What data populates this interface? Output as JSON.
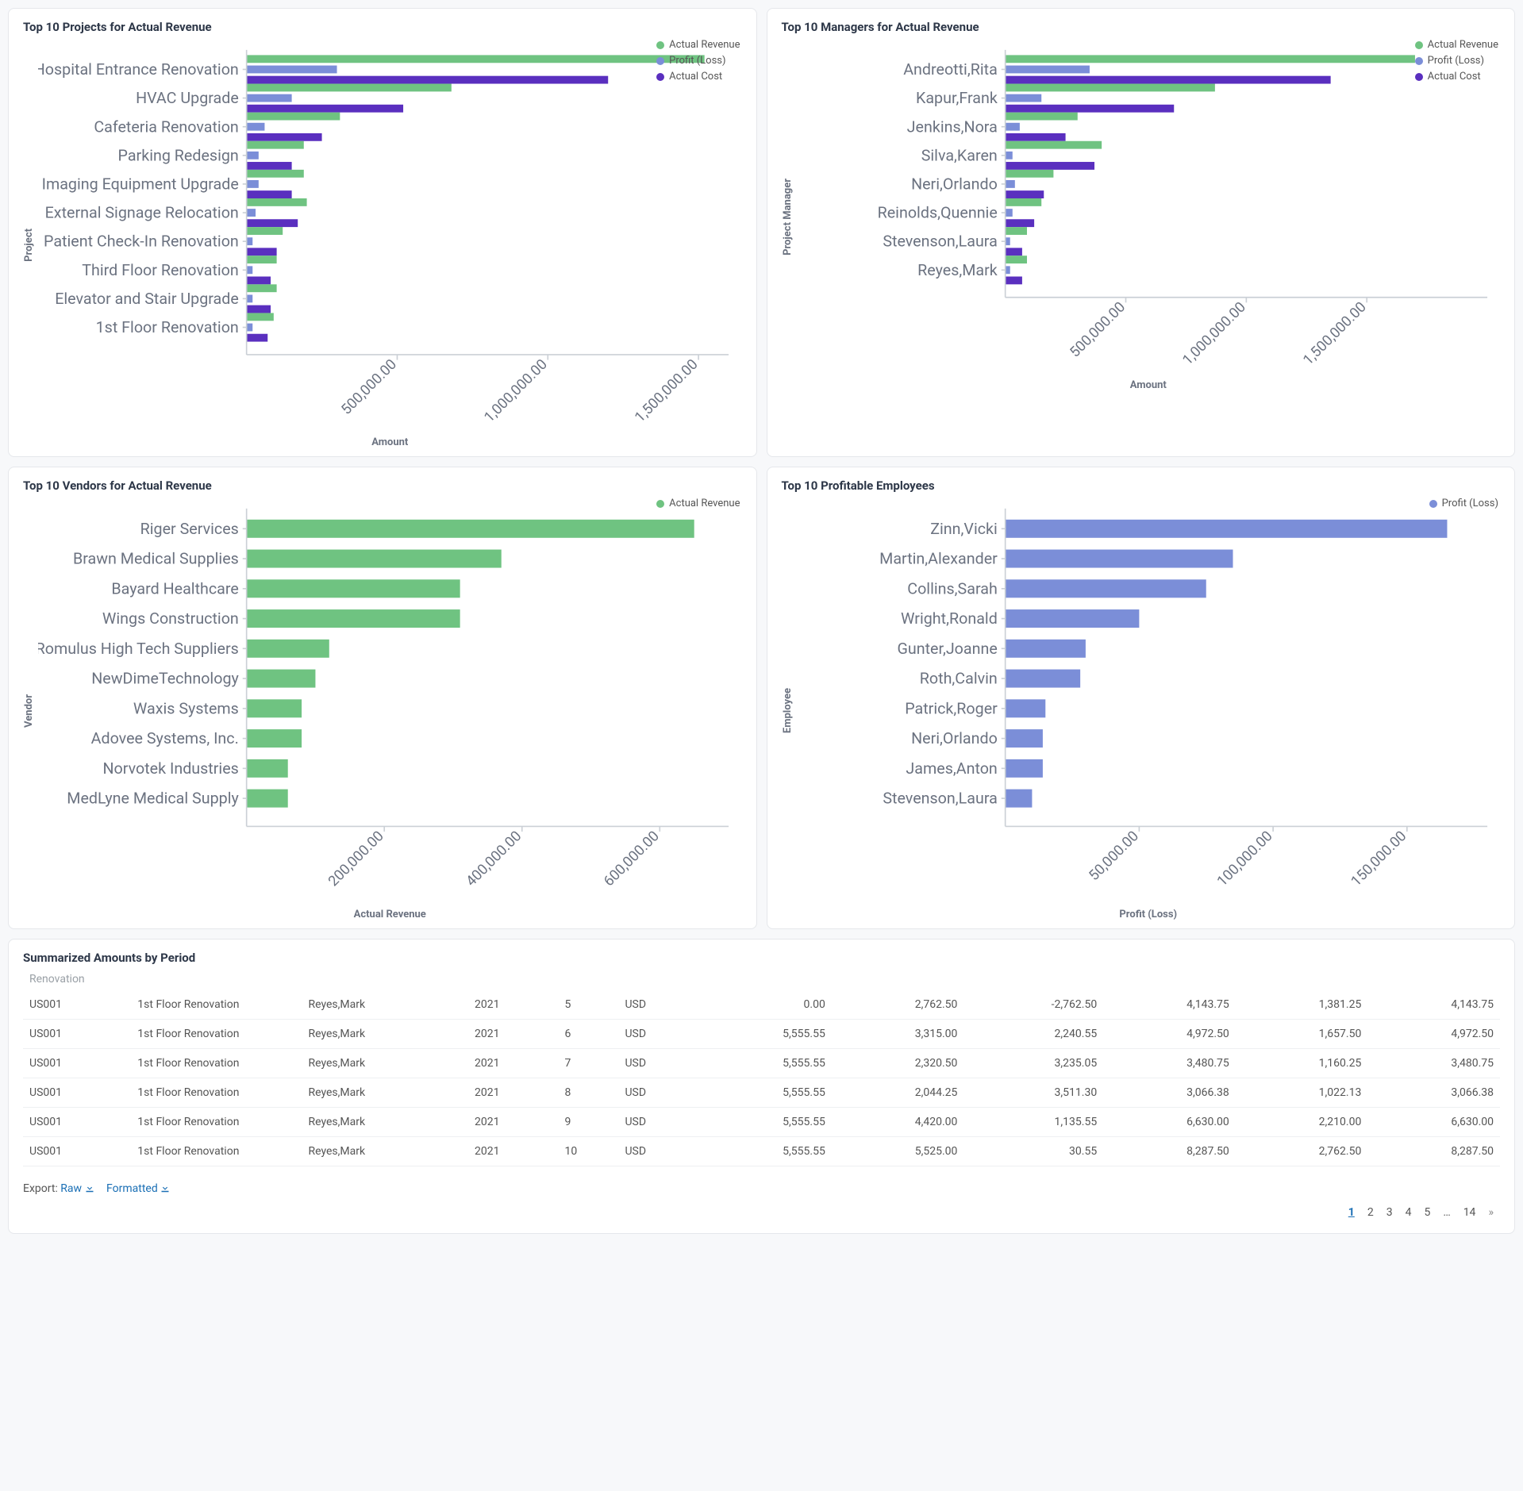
{
  "colors": {
    "green": "#6fc381",
    "blue": "#7b8ed8",
    "purple": "#5a2fbf"
  },
  "chart_data": [
    {
      "id": "projects",
      "type": "bar",
      "orientation": "horizontal",
      "title": "Top 10 Projects for Actual Revenue",
      "ylabel": "Project",
      "xlabel": "Amount",
      "xlim": [
        0,
        1600000
      ],
      "xticks": [
        "500,000.00",
        "1,000,000.00",
        "1,500,000.00"
      ],
      "xtick_vals": [
        500000,
        1000000,
        1500000
      ],
      "categories": [
        "Hospital Entrance Renovation",
        "HVAC Upgrade",
        "Cafeteria Renovation",
        "Parking Redesign",
        "Imaging Equipment Upgrade",
        "External Signage Relocation",
        "Patient Check-In Renovation",
        "Third Floor Renovation",
        "Elevator and Stair Upgrade",
        "1st Floor Renovation"
      ],
      "series": [
        {
          "name": "Actual Revenue",
          "color_key": "green",
          "values": [
            1520000,
            680000,
            310000,
            190000,
            190000,
            200000,
            120000,
            100000,
            100000,
            90000
          ]
        },
        {
          "name": "Profit (Loss)",
          "color_key": "blue",
          "values": [
            300000,
            150000,
            60000,
            40000,
            40000,
            30000,
            20000,
            20000,
            20000,
            20000
          ]
        },
        {
          "name": "Actual Cost",
          "color_key": "purple",
          "values": [
            1200000,
            520000,
            250000,
            150000,
            150000,
            170000,
            100000,
            80000,
            80000,
            70000
          ]
        }
      ]
    },
    {
      "id": "managers",
      "type": "bar",
      "orientation": "horizontal",
      "title": "Top 10 Managers for Actual Revenue",
      "ylabel": "Project Manager",
      "xlabel": "Amount",
      "xlim": [
        0,
        2000000
      ],
      "xticks": [
        "500,000.00",
        "1,000,000.00",
        "1,500,000.00"
      ],
      "xtick_vals": [
        500000,
        1000000,
        1500000
      ],
      "categories": [
        "Andreotti,Rita",
        "Kapur,Frank",
        "Jenkins,Nora",
        "Silva,Karen",
        "Neri,Orlando",
        "Reinolds,Quennie",
        "Stevenson,Laura",
        "Reyes,Mark"
      ],
      "series": [
        {
          "name": "Actual Revenue",
          "color_key": "green",
          "values": [
            1700000,
            870000,
            300000,
            400000,
            200000,
            150000,
            90000,
            90000
          ]
        },
        {
          "name": "Profit (Loss)",
          "color_key": "blue",
          "values": [
            350000,
            150000,
            60000,
            30000,
            40000,
            30000,
            20000,
            20000
          ]
        },
        {
          "name": "Actual Cost",
          "color_key": "purple",
          "values": [
            1350000,
            700000,
            250000,
            370000,
            160000,
            120000,
            70000,
            70000
          ]
        }
      ]
    },
    {
      "id": "vendors",
      "type": "bar",
      "orientation": "horizontal",
      "title": "Top 10 Vendors for Actual Revenue",
      "ylabel": "Vendor",
      "xlabel": "Actual Revenue",
      "xlim": [
        0,
        700000
      ],
      "xticks": [
        "200,000.00",
        "400,000.00",
        "600,000.00"
      ],
      "xtick_vals": [
        200000,
        400000,
        600000
      ],
      "categories": [
        "Riger Services",
        "Brawn Medical Supplies",
        "Bayard Healthcare",
        "Wings Construction",
        "Romulus High Tech Suppliers",
        "NewDimeTechnology",
        "Waxis Systems",
        "Adovee Systems, Inc.",
        "Norvotek Industries",
        "MedLyne Medical Supply"
      ],
      "series": [
        {
          "name": "Actual Revenue",
          "color_key": "green",
          "values": [
            650000,
            370000,
            310000,
            310000,
            120000,
            100000,
            80000,
            80000,
            60000,
            60000
          ]
        }
      ]
    },
    {
      "id": "employees",
      "type": "bar",
      "orientation": "horizontal",
      "title": "Top 10 Profitable Employees",
      "ylabel": "Employee",
      "xlabel": "Profit (Loss)",
      "xlim": [
        0,
        180000
      ],
      "xticks": [
        "50,000.00",
        "100,000.00",
        "150,000.00"
      ],
      "xtick_vals": [
        50000,
        100000,
        150000
      ],
      "categories": [
        "Zinn,Vicki",
        "Martin,Alexander",
        "Collins,Sarah",
        "Wright,Ronald",
        "Gunter,Joanne",
        "Roth,Calvin",
        "Patrick,Roger",
        "Neri,Orlando",
        "James,Anton",
        "Stevenson,Laura"
      ],
      "series": [
        {
          "name": "Profit (Loss)",
          "color_key": "blue",
          "values": [
            165000,
            85000,
            75000,
            50000,
            30000,
            28000,
            15000,
            14000,
            14000,
            10000
          ]
        }
      ]
    }
  ],
  "table": {
    "title": "Summarized Amounts by Period",
    "partial_row_text": "Renovation",
    "rows": [
      {
        "c0": "US001",
        "c1": "1st Floor Renovation",
        "c2": "Reyes,Mark",
        "c3": "2021",
        "c4": "5",
        "c5": "USD",
        "c6": "0.00",
        "c7": "2,762.50",
        "c8": "-2,762.50",
        "c9": "4,143.75",
        "c10": "1,381.25",
        "c11": "4,143.75"
      },
      {
        "c0": "US001",
        "c1": "1st Floor Renovation",
        "c2": "Reyes,Mark",
        "c3": "2021",
        "c4": "6",
        "c5": "USD",
        "c6": "5,555.55",
        "c7": "3,315.00",
        "c8": "2,240.55",
        "c9": "4,972.50",
        "c10": "1,657.50",
        "c11": "4,972.50"
      },
      {
        "c0": "US001",
        "c1": "1st Floor Renovation",
        "c2": "Reyes,Mark",
        "c3": "2021",
        "c4": "7",
        "c5": "USD",
        "c6": "5,555.55",
        "c7": "2,320.50",
        "c8": "3,235.05",
        "c9": "3,480.75",
        "c10": "1,160.25",
        "c11": "3,480.75"
      },
      {
        "c0": "US001",
        "c1": "1st Floor Renovation",
        "c2": "Reyes,Mark",
        "c3": "2021",
        "c4": "8",
        "c5": "USD",
        "c6": "5,555.55",
        "c7": "2,044.25",
        "c8": "3,511.30",
        "c9": "3,066.38",
        "c10": "1,022.13",
        "c11": "3,066.38"
      },
      {
        "c0": "US001",
        "c1": "1st Floor Renovation",
        "c2": "Reyes,Mark",
        "c3": "2021",
        "c4": "9",
        "c5": "USD",
        "c6": "5,555.55",
        "c7": "4,420.00",
        "c8": "1,135.55",
        "c9": "6,630.00",
        "c10": "2,210.00",
        "c11": "6,630.00"
      },
      {
        "c0": "US001",
        "c1": "1st Floor Renovation",
        "c2": "Reyes,Mark",
        "c3": "2021",
        "c4": "10",
        "c5": "USD",
        "c6": "5,555.55",
        "c7": "5,525.00",
        "c8": "30.55",
        "c9": "8,287.50",
        "c10": "2,762.50",
        "c11": "8,287.50"
      }
    ],
    "export_label": "Export:",
    "export_raw": "Raw",
    "export_formatted": "Formatted",
    "pages": [
      "1",
      "2",
      "3",
      "4",
      "5",
      "…",
      "14"
    ],
    "page_next": "»"
  }
}
